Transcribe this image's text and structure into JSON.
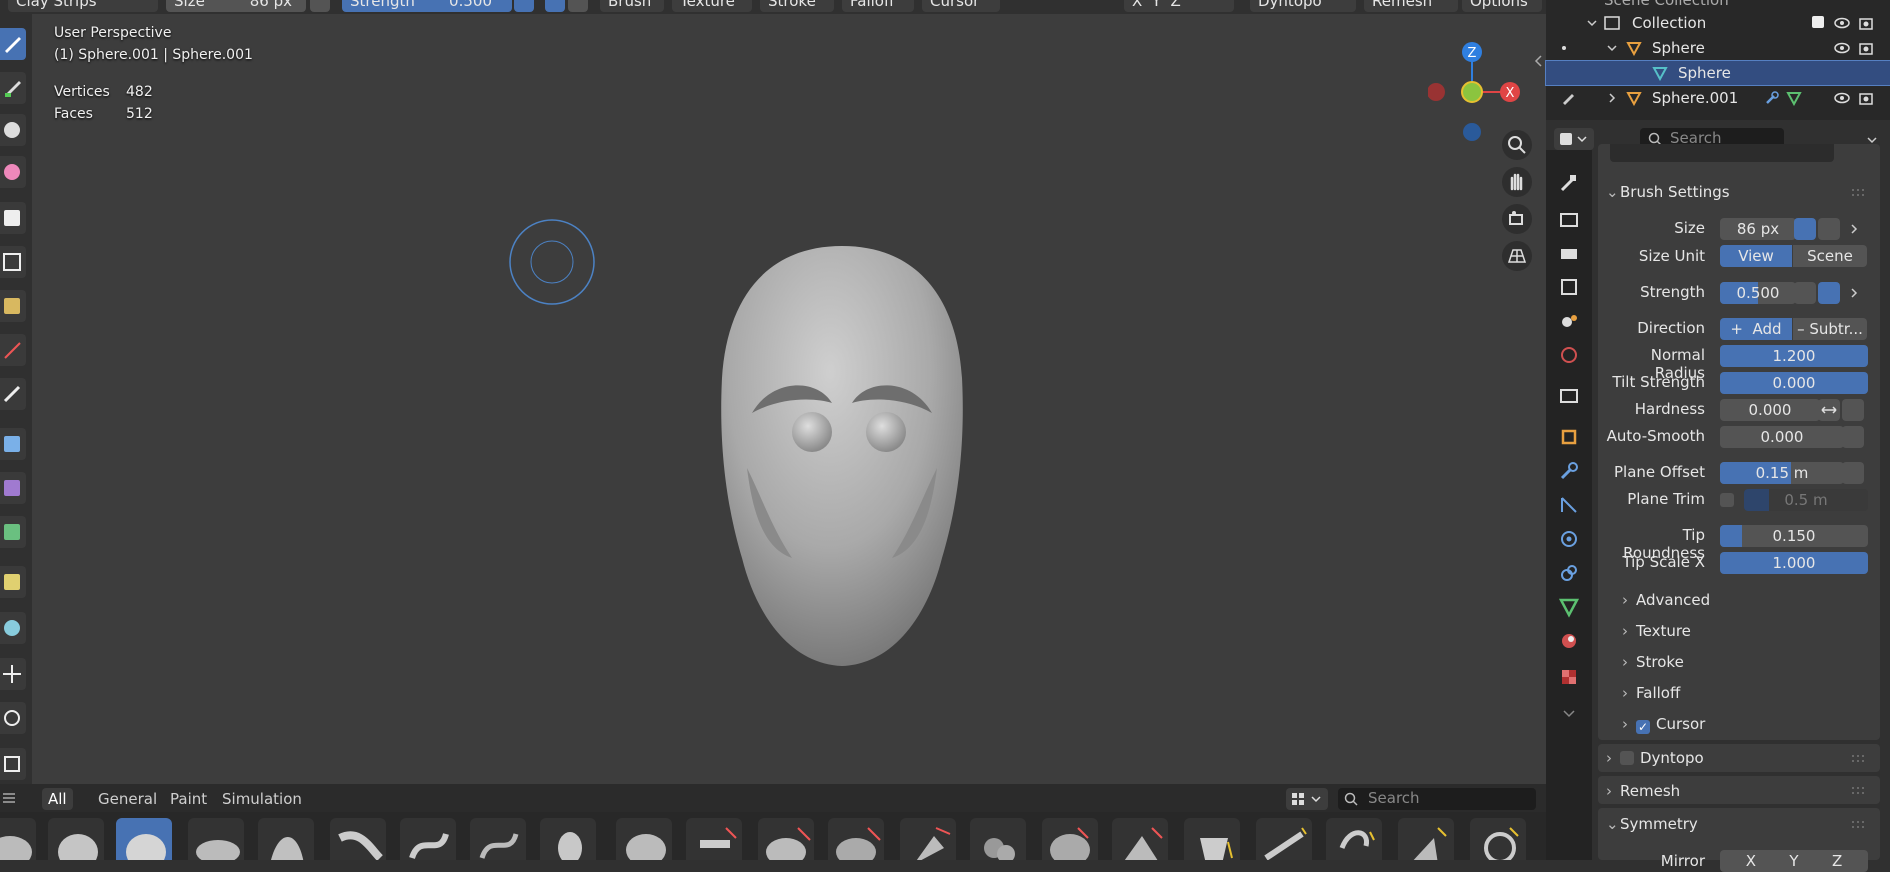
{
  "header": {
    "brush_name": "Clay Strips",
    "size_label": "Size",
    "size_value": "86 px",
    "strength_label": "Strength",
    "strength_value": "0.500",
    "menus": [
      "Brush",
      "Texture",
      "Stroke",
      "Falloff",
      "Cursor"
    ],
    "sym": [
      "X",
      "Y",
      "Z"
    ],
    "right_menus": [
      "Dyntopo",
      "Remesh",
      "Options"
    ]
  },
  "viewport": {
    "perspective": "User Perspective",
    "object_info": "(1) Sphere.001 | Sphere.001",
    "vertices_label": "Vertices",
    "vertices_value": "482",
    "faces_label": "Faces",
    "faces_value": "512",
    "gizmo": {
      "z": "Z",
      "x": "X"
    }
  },
  "asset_shelf": {
    "tabs": [
      "All",
      "General",
      "Paint",
      "Simulation"
    ],
    "search_placeholder": "Search"
  },
  "outliner": {
    "scene_collection": "Scene Collection",
    "collection": "Collection",
    "sphere": "Sphere",
    "sphere_mesh": "Sphere",
    "sphere001": "Sphere.001"
  },
  "properties": {
    "search_placeholder": "Search",
    "brush_settings": "Brush Settings",
    "size_label": "Size",
    "size_value": "86 px",
    "size_unit_label": "Size Unit",
    "size_unit_view": "View",
    "size_unit_scene": "Scene",
    "strength_label": "Strength",
    "strength_value": "0.500",
    "direction_label": "Direction",
    "direction_add": "Add",
    "direction_sub": "Subtr...",
    "normal_radius_label": "Normal Radius",
    "normal_radius_value": "1.200",
    "tilt_strength_label": "Tilt Strength",
    "tilt_strength_value": "0.000",
    "hardness_label": "Hardness",
    "hardness_value": "0.000",
    "auto_smooth_label": "Auto-Smooth",
    "auto_smooth_value": "0.000",
    "plane_offset_label": "Plane Offset",
    "plane_offset_value": "0.15 m",
    "plane_offset_fill": 0.57,
    "plane_trim_label": "Plane Trim",
    "plane_trim_value": "0.5 m",
    "tip_roundness_label": "Tip Roundness",
    "tip_roundness_value": "0.150",
    "tip_roundness_fill": 0.15,
    "tip_scale_x_label": "Tip Scale X",
    "tip_scale_x_value": "1.000",
    "advanced": "Advanced",
    "texture": "Texture",
    "stroke": "Stroke",
    "falloff": "Falloff",
    "cursor": "Cursor",
    "dyntopo": "Dyntopo",
    "remesh": "Remesh",
    "symmetry": "Symmetry",
    "mirror_label": "Mirror"
  }
}
